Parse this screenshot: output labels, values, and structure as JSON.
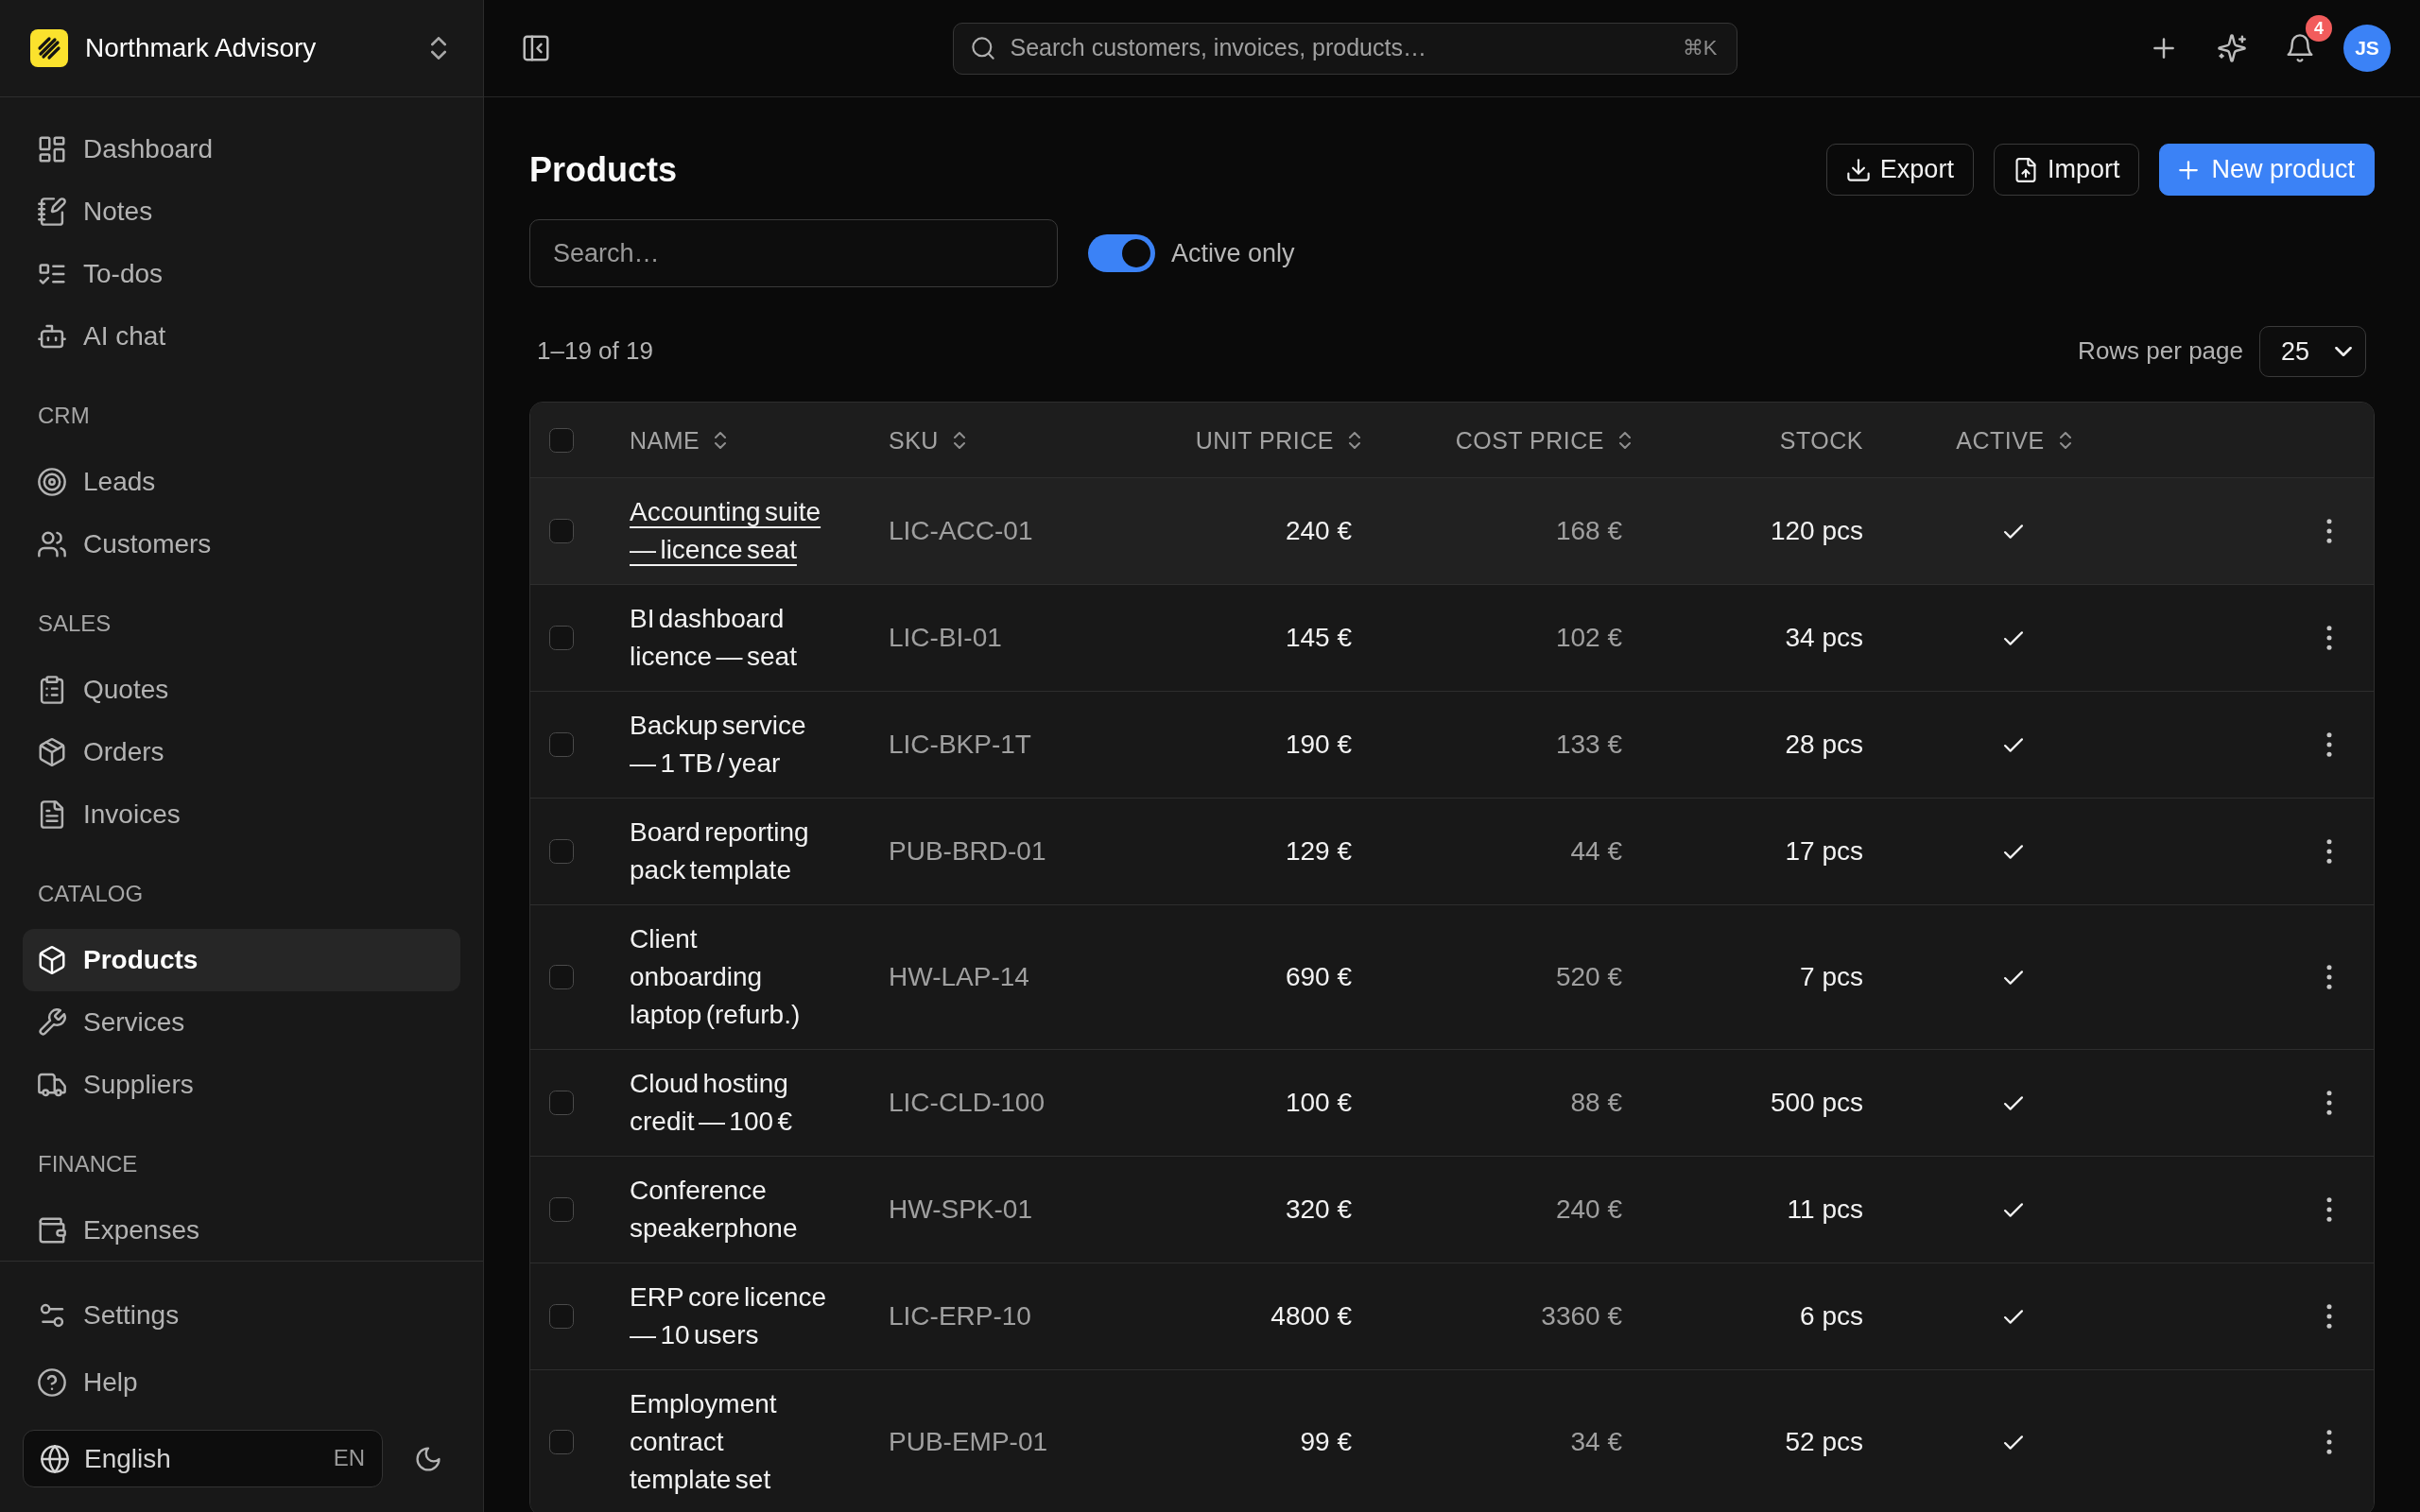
{
  "sidebar": {
    "workspace": {
      "name": "Northmark Advisory"
    },
    "groups": [
      {
        "items": [
          {
            "label": "Dashboard",
            "selected": false
          },
          {
            "label": "Notes",
            "selected": false
          },
          {
            "label": "To-dos",
            "selected": false
          },
          {
            "label": "AI chat",
            "selected": false
          }
        ]
      },
      {
        "title": "CRM",
        "items": [
          {
            "label": "Leads",
            "selected": false
          },
          {
            "label": "Customers",
            "selected": false
          }
        ]
      },
      {
        "title": "SALES",
        "items": [
          {
            "label": "Quotes",
            "selected": false
          },
          {
            "label": "Orders",
            "selected": false
          },
          {
            "label": "Invoices",
            "selected": false
          }
        ]
      },
      {
        "title": "CATALOG",
        "items": [
          {
            "label": "Products",
            "selected": true
          },
          {
            "label": "Services",
            "selected": false
          },
          {
            "label": "Suppliers",
            "selected": false
          }
        ]
      },
      {
        "title": "FINANCE",
        "items": [
          {
            "label": "Expenses",
            "selected": false
          }
        ]
      }
    ],
    "footer_items": [
      {
        "label": "Settings"
      },
      {
        "label": "Help"
      }
    ],
    "language": {
      "label": "English",
      "code": "EN"
    }
  },
  "topbar": {
    "search": {
      "placeholder": "Search customers, invoices, products…",
      "shortcut": "⌘K"
    },
    "notifications": {
      "count": "4"
    },
    "user": {
      "initials": "JS"
    }
  },
  "page": {
    "title": "Products",
    "actions": [
      {
        "label": "Export",
        "kind": "outline"
      },
      {
        "label": "Import",
        "kind": "outline"
      },
      {
        "label": "New product",
        "kind": "primary"
      }
    ]
  },
  "filters": {
    "search": {
      "placeholder": "Search…"
    },
    "active_only": {
      "label": "Active only",
      "on": true
    }
  },
  "pagination": {
    "range": "1–19 of 19",
    "rows_per_page_label": "Rows per page",
    "rows_per_page": "25"
  },
  "table": {
    "select_all": {
      "checked": false
    },
    "columns": [
      {
        "label": "NAME",
        "sortable": true
      },
      {
        "label": "SKU",
        "sortable": true
      },
      {
        "label": "UNIT PRICE",
        "sortable": true
      },
      {
        "label": "COST PRICE",
        "sortable": true
      },
      {
        "label": "STOCK",
        "sortable": false
      },
      {
        "label": "ACTIVE",
        "sortable": true
      }
    ],
    "rows": [
      {
        "name": "Accounting suite — licence seat",
        "sku": "LIC-ACC-01",
        "unit_price": "240 €",
        "cost_price": "168 €",
        "stock": "120 pcs",
        "active": true,
        "selected": false,
        "hovered": true
      },
      {
        "name": "BI dashboard licence — seat",
        "sku": "LIC-BI-01",
        "unit_price": "145 €",
        "cost_price": "102 €",
        "stock": "34 pcs",
        "active": true,
        "selected": false,
        "hovered": false
      },
      {
        "name": "Backup service — 1 TB / year",
        "sku": "LIC-BKP-1T",
        "unit_price": "190 €",
        "cost_price": "133 €",
        "stock": "28 pcs",
        "active": true,
        "selected": false,
        "hovered": false
      },
      {
        "name": "Board reporting pack template",
        "sku": "PUB-BRD-01",
        "unit_price": "129 €",
        "cost_price": "44 €",
        "stock": "17 pcs",
        "active": true,
        "selected": false,
        "hovered": false
      },
      {
        "name": "Client onboarding laptop (refurb.)",
        "sku": "HW-LAP-14",
        "unit_price": "690 €",
        "cost_price": "520 €",
        "stock": "7 pcs",
        "active": true,
        "selected": false,
        "hovered": false
      },
      {
        "name": "Cloud hosting credit — 100 €",
        "sku": "LIC-CLD-100",
        "unit_price": "100 €",
        "cost_price": "88 €",
        "stock": "500 pcs",
        "active": true,
        "selected": false,
        "hovered": false
      },
      {
        "name": "Conference speakerphone",
        "sku": "HW-SPK-01",
        "unit_price": "320 €",
        "cost_price": "240 €",
        "stock": "11 pcs",
        "active": true,
        "selected": false,
        "hovered": false
      },
      {
        "name": "ERP core licence — 10 users",
        "sku": "LIC-ERP-10",
        "unit_price": "4800 €",
        "cost_price": "3360 €",
        "stock": "6 pcs",
        "active": true,
        "selected": false,
        "hovered": false
      },
      {
        "name": "Employment contract template set",
        "sku": "PUB-EMP-01",
        "unit_price": "99 €",
        "cost_price": "34 €",
        "stock": "52 pcs",
        "active": true,
        "selected": false,
        "hovered": false
      }
    ]
  }
}
